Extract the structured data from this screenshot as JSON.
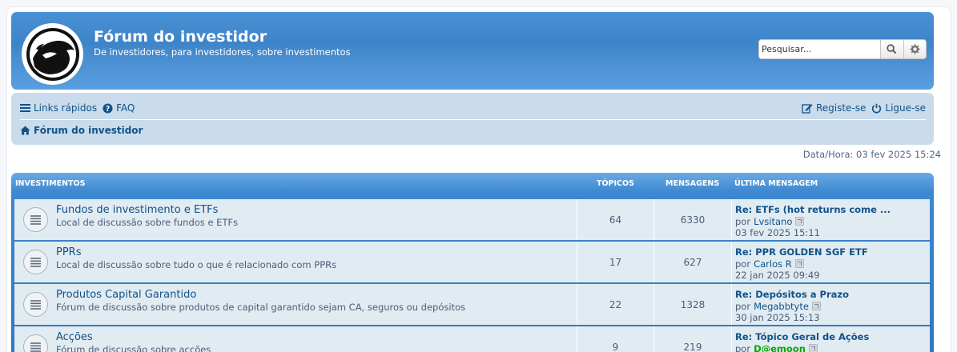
{
  "header": {
    "site_title": "Fórum do investidor",
    "site_description": "De investidores, para investidores, sobre investimentos",
    "search_placeholder": "Pesquisar...",
    "logo_icon": "bull-bear-logo",
    "colors": {
      "header_blue": "#3e84c9",
      "nav_bg": "#cadceb",
      "link": "#105289"
    }
  },
  "navbar": {
    "quick_links": "Links rápidos",
    "faq": "FAQ",
    "register": "Registe-se",
    "login": "Ligue-se",
    "breadcrumb_home": "Fórum do investidor"
  },
  "datetime": "Data/Hora: 03 fev 2025 15:24",
  "forum_table": {
    "headers": {
      "category": "INVESTIMENTOS",
      "topics": "TÓPICOS",
      "messages": "MENSAGENS",
      "last_message": "ÚLTIMA MENSAGEM"
    },
    "rows": [
      {
        "title": "Fundos de investimento e ETFs",
        "description": "Local de discussão sobre fundos e ETFs",
        "topics": "64",
        "messages": "6330",
        "last_title": "Re: ETFs (hot returns come ...",
        "by_prefix": "por",
        "last_user": "Lvsitano",
        "last_date": "03 fev 2025 15:11"
      },
      {
        "title": "PPRs",
        "description": "Local de discussão sobre tudo o que é relacionado com PPRs",
        "topics": "17",
        "messages": "627",
        "last_title": "Re: PPR GOLDEN SGF ETF",
        "by_prefix": "por",
        "last_user": "Carlos R",
        "last_date": "22 jan 2025 09:49"
      },
      {
        "title": "Produtos Capital Garantido",
        "description": "Fórum de discussão sobre produtos de capital garantido sejam CA, seguros ou depósitos",
        "topics": "22",
        "messages": "1328",
        "last_title": "Re: Depósitos a Prazo",
        "by_prefix": "por",
        "last_user": "Megabbtyte",
        "last_date": "30 jan 2025 15:13"
      },
      {
        "title": "Acções",
        "description": "Fórum de discussão sobre acções",
        "topics": "9",
        "messages": "219",
        "last_title": "Re: Tópico Geral de Ações",
        "by_prefix": "por",
        "last_user": "D@emoon",
        "last_date": ""
      }
    ]
  }
}
